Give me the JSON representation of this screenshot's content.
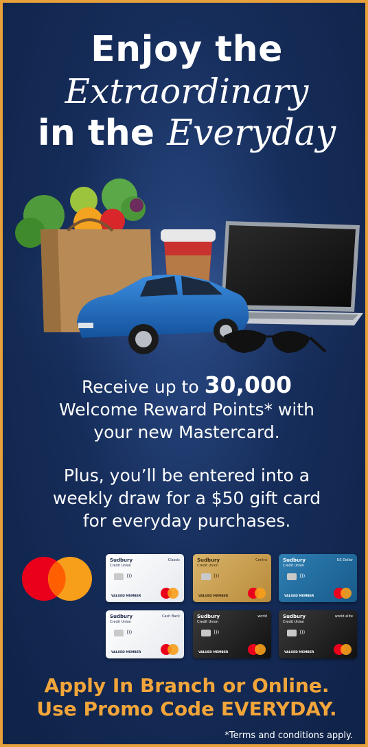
{
  "headline": {
    "line1": "Enjoy the",
    "line2": "Extraordinary",
    "line3_prefix": "in the",
    "line3_script": "Everyday"
  },
  "offer": {
    "line1_prefix": "Receive up to",
    "points": "30,000",
    "line2": "Welcome Reward Points* with",
    "line3": "your new Mastercard."
  },
  "draw": {
    "line1": "Plus, you’ll be entered into a",
    "line2": "weekly draw for a $50 gift card",
    "line3": "for everyday purchases."
  },
  "cards": [
    {
      "brand": "Sudbury",
      "sub": "Credit Union",
      "tier": "Classic",
      "member": "VALUED MEMBER",
      "style": "white"
    },
    {
      "brand": "Sudbury",
      "sub": "Credit Union",
      "tier": "Centra",
      "member": "VALUED MEMBER",
      "style": "gold"
    },
    {
      "brand": "Sudbury",
      "sub": "Credit Union",
      "tier": "US Dollar",
      "member": "VALUED MEMBER",
      "style": "blue"
    },
    {
      "brand": "Sudbury",
      "sub": "Credit Union",
      "tier": "Cash Back",
      "member": "VALUED MEMBER",
      "style": "white"
    },
    {
      "brand": "Sudbury",
      "sub": "Credit Union",
      "tier": "world",
      "member": "VALUED MEMBER",
      "style": "black"
    },
    {
      "brand": "Sudbury",
      "sub": "Credit Union",
      "tier": "world elite",
      "member": "VALUED MEMBER",
      "style": "black"
    }
  ],
  "cta": {
    "line1": "Apply In Branch or Online.",
    "line2": "Use Promo Code EVERYDAY."
  },
  "terms": "*Terms and conditions apply.",
  "colors": {
    "background": "#162d5a",
    "border": "#e8a13a",
    "cta": "#f2a53a",
    "mastercard_red": "#eb001b",
    "mastercard_orange": "#f79e1b"
  },
  "illustration_items": [
    "grocery-bag-icon",
    "coffee-cup-icon",
    "blue-car-icon",
    "laptop-icon",
    "sunglasses-icon"
  ]
}
